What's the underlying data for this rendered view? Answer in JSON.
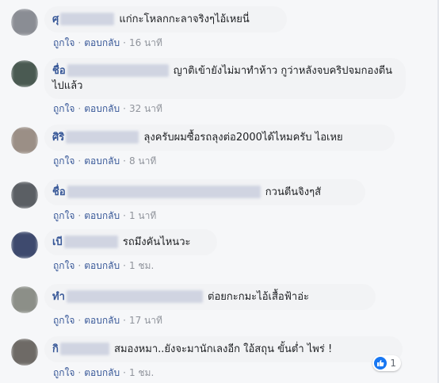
{
  "comments": [
    {
      "name": "ศุ",
      "text": "แก่กะโหลกกะลาจริงๆไอ้เหยนี่",
      "like_label": "ถูกใจ",
      "reply_label": "ตอบกลับ",
      "time": "16 นาที",
      "avatar_color": "#8a8d94"
    },
    {
      "name": "ชื่อ",
      "text": "ญาติเข้ายังไม่มาทำห้าว กูว่าหลังจบคริปจมกองตีนไปแล้ว",
      "like_label": "ถูกใจ",
      "reply_label": "ตอบกลับ",
      "time": "32 นาที",
      "avatar_color": "#4a5a52"
    },
    {
      "name": "ศิริ",
      "text": "ลุงครับผมซื้อรถลุงต่อ2000ได้ไหมครับ ไอเหย",
      "like_label": "ถูกใจ",
      "reply_label": "ตอบกลับ",
      "time": "8 นาที",
      "avatar_color": "#9b8f86"
    },
    {
      "name": "ชื่อ",
      "text": "กวนตีนจิงๆสั",
      "like_label": "ถูกใจ",
      "reply_label": "ตอบกลับ",
      "time": "1 นาที",
      "avatar_color": "#5b5f64"
    },
    {
      "name": "เบี",
      "text": "รถมึงคันไหนวะ",
      "like_label": "ถูกใจ",
      "reply_label": "ตอบกลับ",
      "time": "1 ชม.",
      "avatar_color": "#3e4a6e"
    },
    {
      "name": "ทำ",
      "text": "ต่อยกะกมะไอ้เสื้อฟ้าอ่ะ",
      "like_label": "ถูกใจ",
      "reply_label": "ตอบกลับ",
      "time": "17 นาที",
      "avatar_color": "#8c8f88"
    },
    {
      "name": "กิ",
      "text": "สมองหมา..ยังจะมานักเลงอีก ใอ้สถุน ขั้นต่ำ ไพร่ !",
      "like_label": "ถูกใจ",
      "reply_label": "ตอบกลับ",
      "time": "1 ชม.",
      "avatar_color": "#6e6a66"
    }
  ],
  "reaction": {
    "icon": "thumbs-up-icon",
    "count": "1",
    "color": "#1877f2"
  }
}
